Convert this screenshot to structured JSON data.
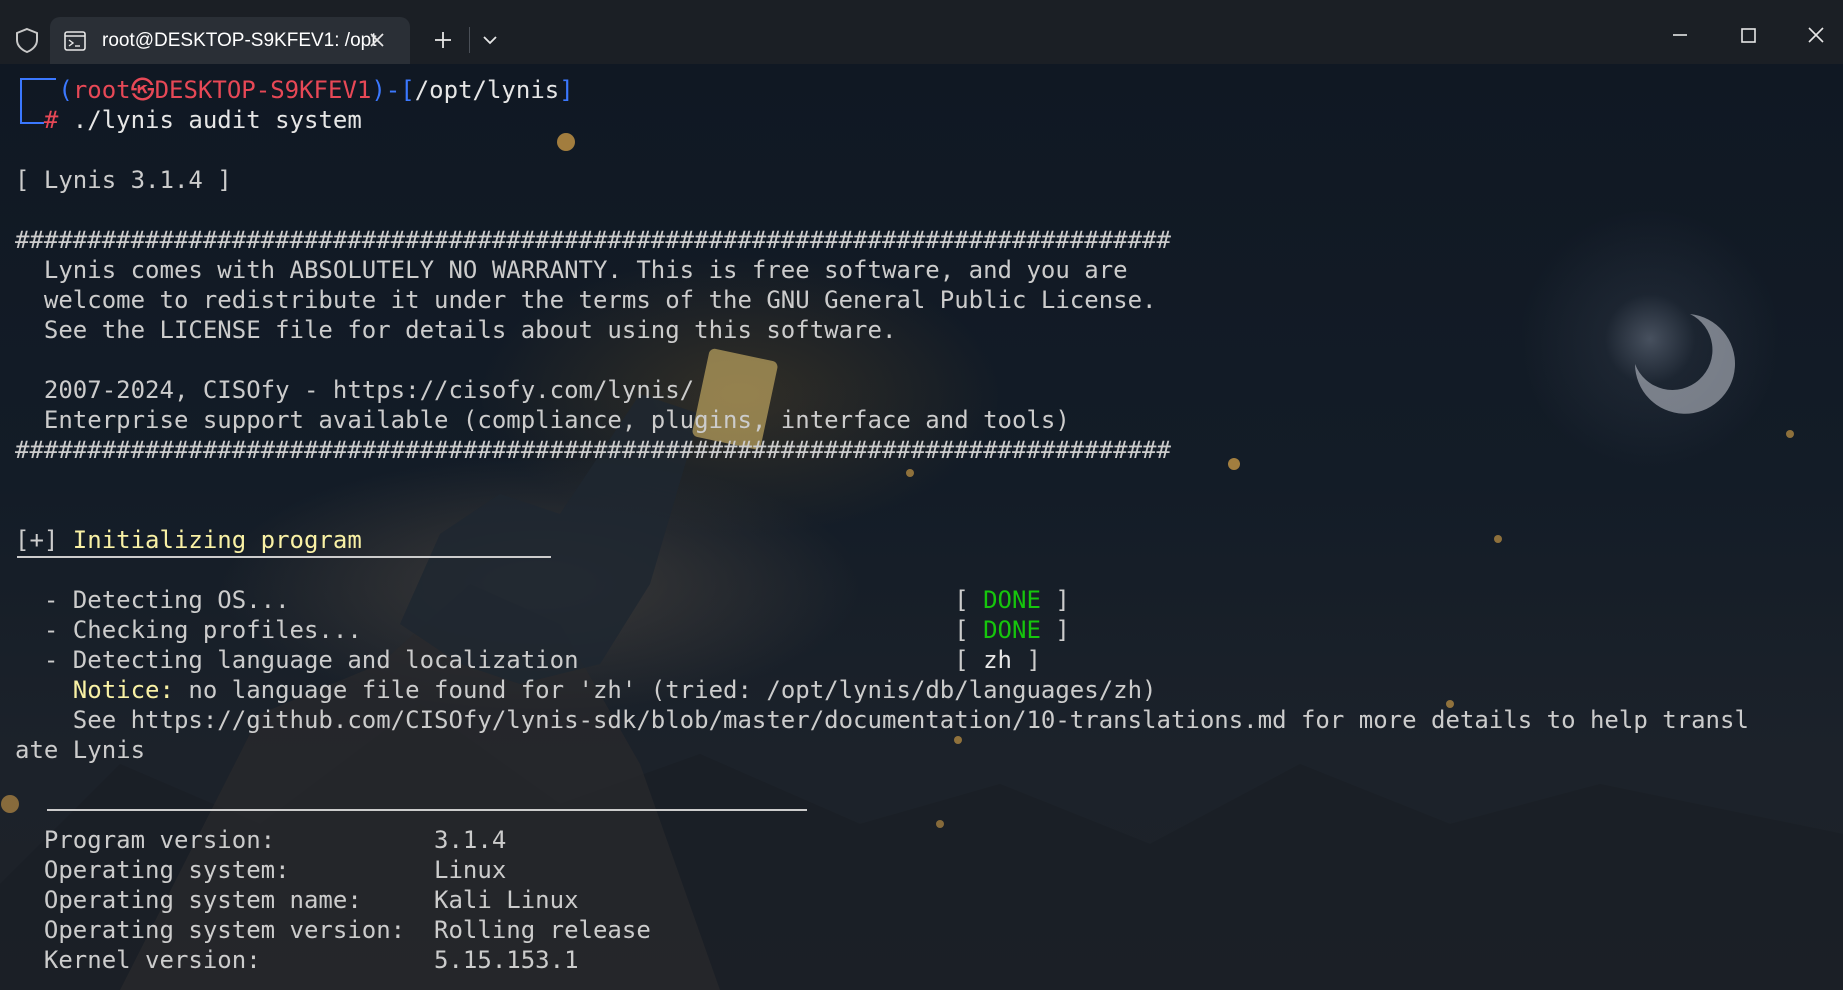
{
  "window": {
    "tab_title": "root@DESKTOP-S9KFEV1: /opt",
    "icons": {
      "shield": "shield-icon",
      "tab": "terminal-icon",
      "tab_close": "close-icon",
      "new_tab": "plus-icon",
      "dropdown": "chevron-down-icon",
      "minimize": "minimize-icon",
      "maximize": "maximize-icon",
      "close": "close-icon"
    }
  },
  "prompt": {
    "open_paren": "(",
    "user": "root",
    "at_symbol": "㉿",
    "host": "DESKTOP-S9KFEV1",
    "close_paren_dash": ")-",
    "dir_open": "[",
    "dir": "/opt/lynis",
    "dir_close": "]",
    "hash": "#",
    "command": " ./lynis audit system"
  },
  "banner": {
    "version_line": "[ Lynis 3.1.4 ]",
    "hash_line": "################################################################################",
    "lines": [
      "  Lynis comes with ABSOLUTELY NO WARRANTY. This is free software, and you are",
      "  welcome to redistribute it under the terms of the GNU General Public License.",
      "  See the LICENSE file for details about using this software.",
      "",
      "  2007-2024, CISOfy - https://cisofy.com/lynis/",
      "  Enterprise support available (compliance, plugins, interface and tools)"
    ]
  },
  "section": {
    "marker": "[+] ",
    "title": "Initializing program"
  },
  "checks": [
    {
      "label": "  - Detecting OS...                                              ",
      "open": "[ ",
      "status": "DONE",
      "close": " ]",
      "status_color": "#16c60c"
    },
    {
      "label": "  - Checking profiles...                                         ",
      "open": "[ ",
      "status": "DONE",
      "close": " ]",
      "status_color": "#16c60c"
    },
    {
      "label": "  - Detecting language and localization                          ",
      "open": "[ ",
      "status": "zh",
      "close": " ]",
      "status_color": "#e6e6e6"
    }
  ],
  "notice": {
    "label": "    Notice:",
    "text": " no language file found for 'zh' (tried: /opt/lynis/db/languages/zh)",
    "see_line": "    See https://github.com/CISOfy/lynis-sdk/blob/master/documentation/10-translations.md for more details to help transl",
    "wrap_line": "ate Lynis"
  },
  "info": [
    {
      "key": "  Program version:           ",
      "value": "3.1.4"
    },
    {
      "key": "  Operating system:          ",
      "value": "Linux"
    },
    {
      "key": "  Operating system name:     ",
      "value": "Kali Linux"
    },
    {
      "key": "  Operating system version:  ",
      "value": "Rolling release"
    },
    {
      "key": "  Kernel version:            ",
      "value": "5.15.153.1"
    }
  ],
  "colors": {
    "prompt_frame": "#3b78ff",
    "prompt_user": "#e74856",
    "section_title": "#f9f1a5",
    "status_done": "#16c60c",
    "terminal_text": "#cccccc"
  }
}
